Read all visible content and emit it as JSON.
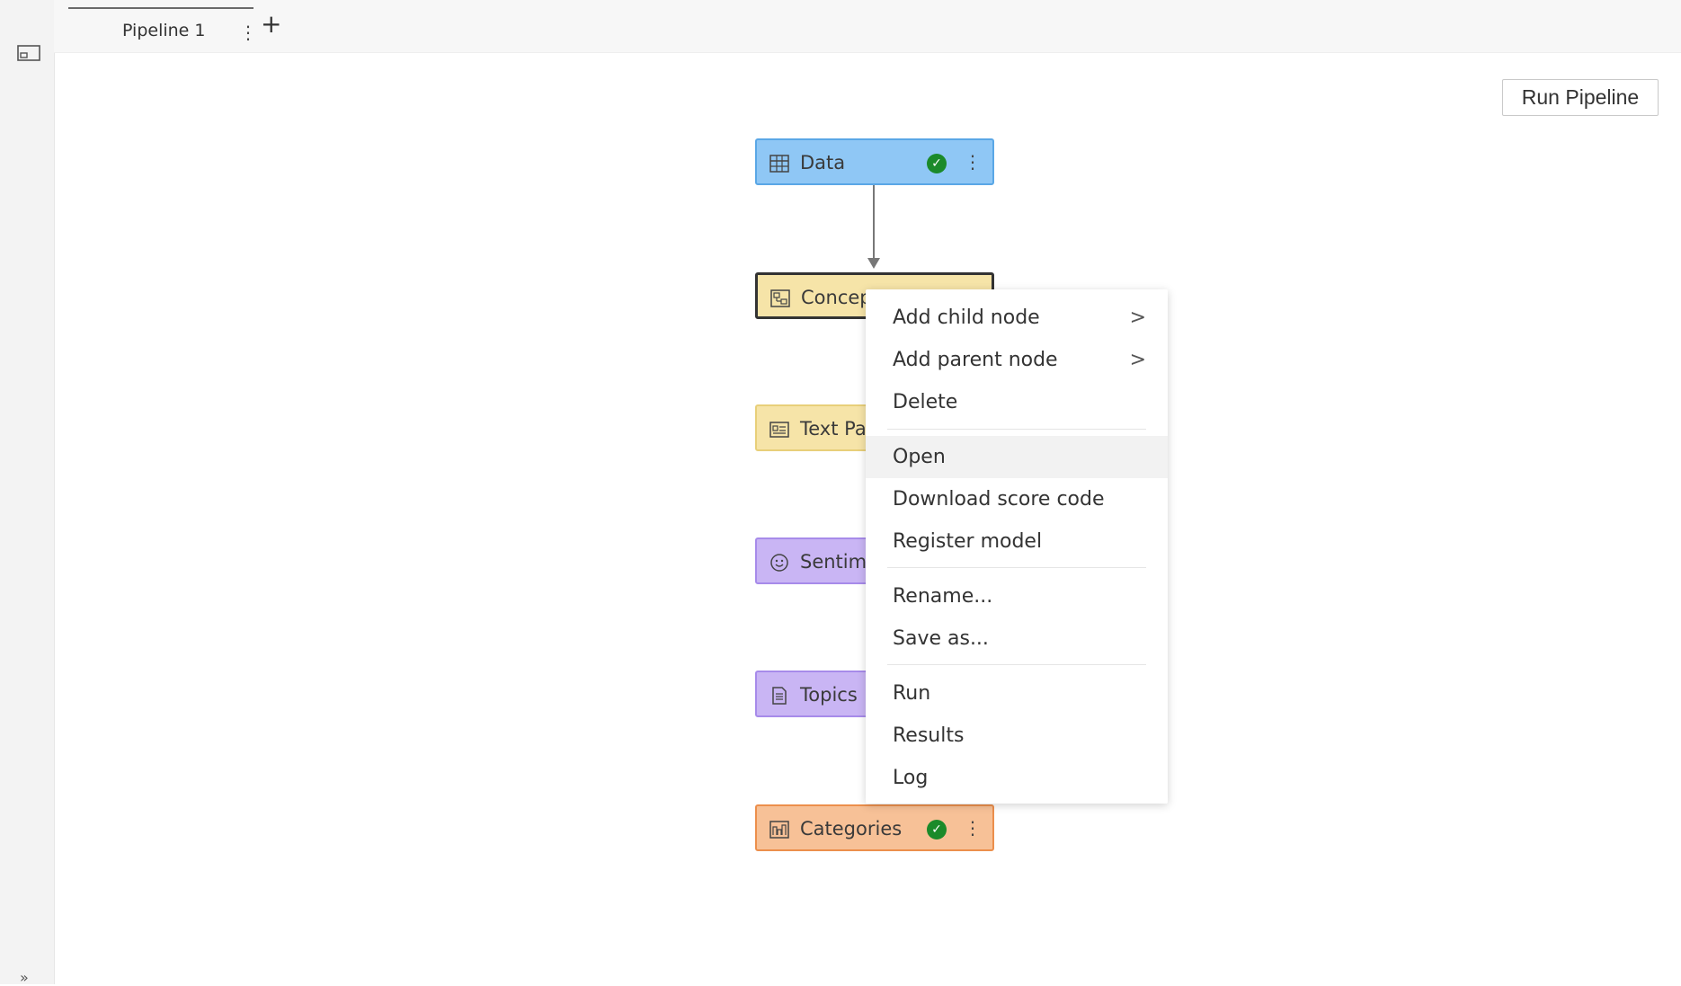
{
  "tab": {
    "label": "Pipeline 1",
    "kebab": "⋮",
    "add": "+"
  },
  "actions": {
    "run_pipeline": "Run Pipeline"
  },
  "rail": {
    "expand": "»"
  },
  "nodes": [
    {
      "label": "Data",
      "status_icon": "check-icon",
      "kebab": "⋮",
      "color": "#8fc7f5"
    },
    {
      "label": "Concep",
      "color": "#f6e4a8"
    },
    {
      "label": "Text Pa",
      "color": "#f6e4a8"
    },
    {
      "label": "Sentim",
      "color": "#c9b5f4"
    },
    {
      "label": "Topics",
      "color": "#c9b5f4"
    },
    {
      "label": "Categories",
      "status_icon": "check-icon",
      "kebab": "⋮",
      "color": "#f7c197"
    }
  ],
  "check_glyph": "✓",
  "context_menu": {
    "items": [
      {
        "label": "Add child node",
        "submenu": ">"
      },
      {
        "label": "Add parent node",
        "submenu": ">"
      },
      {
        "label": "Delete"
      },
      {
        "label": "Open",
        "hover": true
      },
      {
        "label": "Download score code"
      },
      {
        "label": "Register model"
      },
      {
        "label": "Rename..."
      },
      {
        "label": "Save as..."
      },
      {
        "label": "Run"
      },
      {
        "label": "Results"
      },
      {
        "label": "Log"
      }
    ]
  }
}
